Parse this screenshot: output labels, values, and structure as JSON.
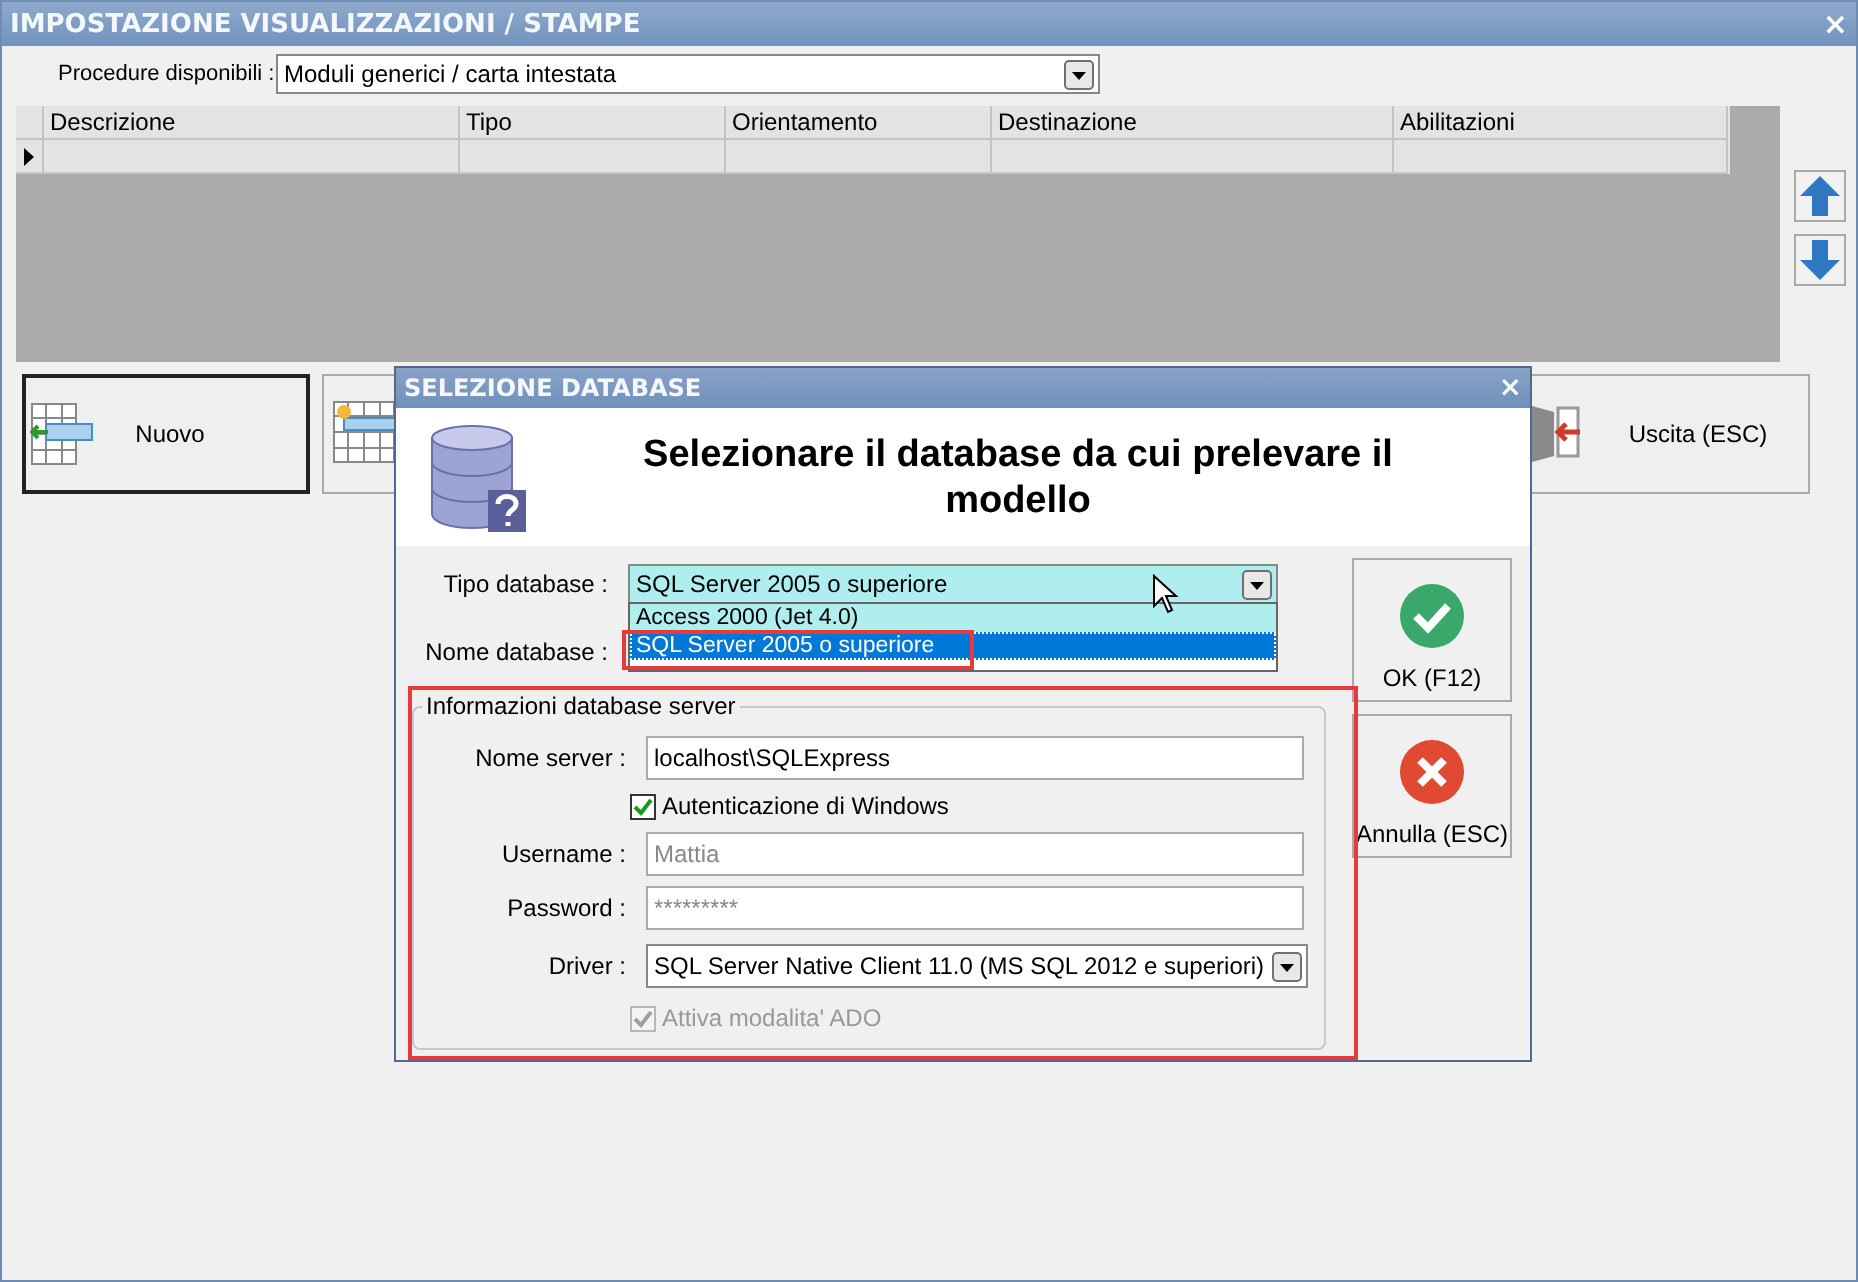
{
  "window": {
    "title": "IMPOSTAZIONE VISUALIZZAZIONI / STAMPE",
    "close": "×"
  },
  "procedure": {
    "label": "Procedure disponibili :",
    "value": "Moduli generici / carta intestata"
  },
  "grid": {
    "columns": [
      "Descrizione",
      "Tipo",
      "Orientamento",
      "Destinazione",
      "Abilitazioni"
    ]
  },
  "buttons": [
    {
      "kind": "new",
      "label": "Nuovo"
    },
    {
      "kind": "star"
    },
    {
      "kind": "exit",
      "label": "Uscita (ESC)"
    }
  ],
  "dialog": {
    "title": "SELEZIONE DATABASE",
    "close": "×",
    "heading": "Selezionare il database da cui prelevare il modello",
    "tipo_database": {
      "label": "Tipo database :",
      "value": "SQL Server 2005 o superiore",
      "options": [
        {
          "label": "Access 2000 (Jet 4.0)",
          "selected": false
        },
        {
          "label": "SQL Server 2005 o superiore",
          "selected": true
        }
      ]
    },
    "nome_database": {
      "label": "Nome database :"
    },
    "server_group": {
      "title": "Informazioni database server",
      "nome_server": {
        "label": "Nome server :",
        "value": "localhost\\SQLExpress"
      },
      "windows_auth": {
        "label": "Autenticazione di Windows",
        "checked": true
      },
      "username": {
        "label": "Username :",
        "value": "Mattia",
        "disabled": true
      },
      "password": {
        "label": "Password :",
        "value": "*********",
        "disabled": true
      },
      "driver": {
        "label": "Driver :",
        "value": "SQL Server Native Client 11.0 (MS SQL 2012 e superiori)"
      },
      "ado": {
        "label": "Attiva modalita' ADO",
        "checked": true,
        "disabled": true
      }
    },
    "ok_button": {
      "label": "OK (F12)"
    },
    "cancel_button": {
      "label": "Annulla (ESC)"
    }
  }
}
